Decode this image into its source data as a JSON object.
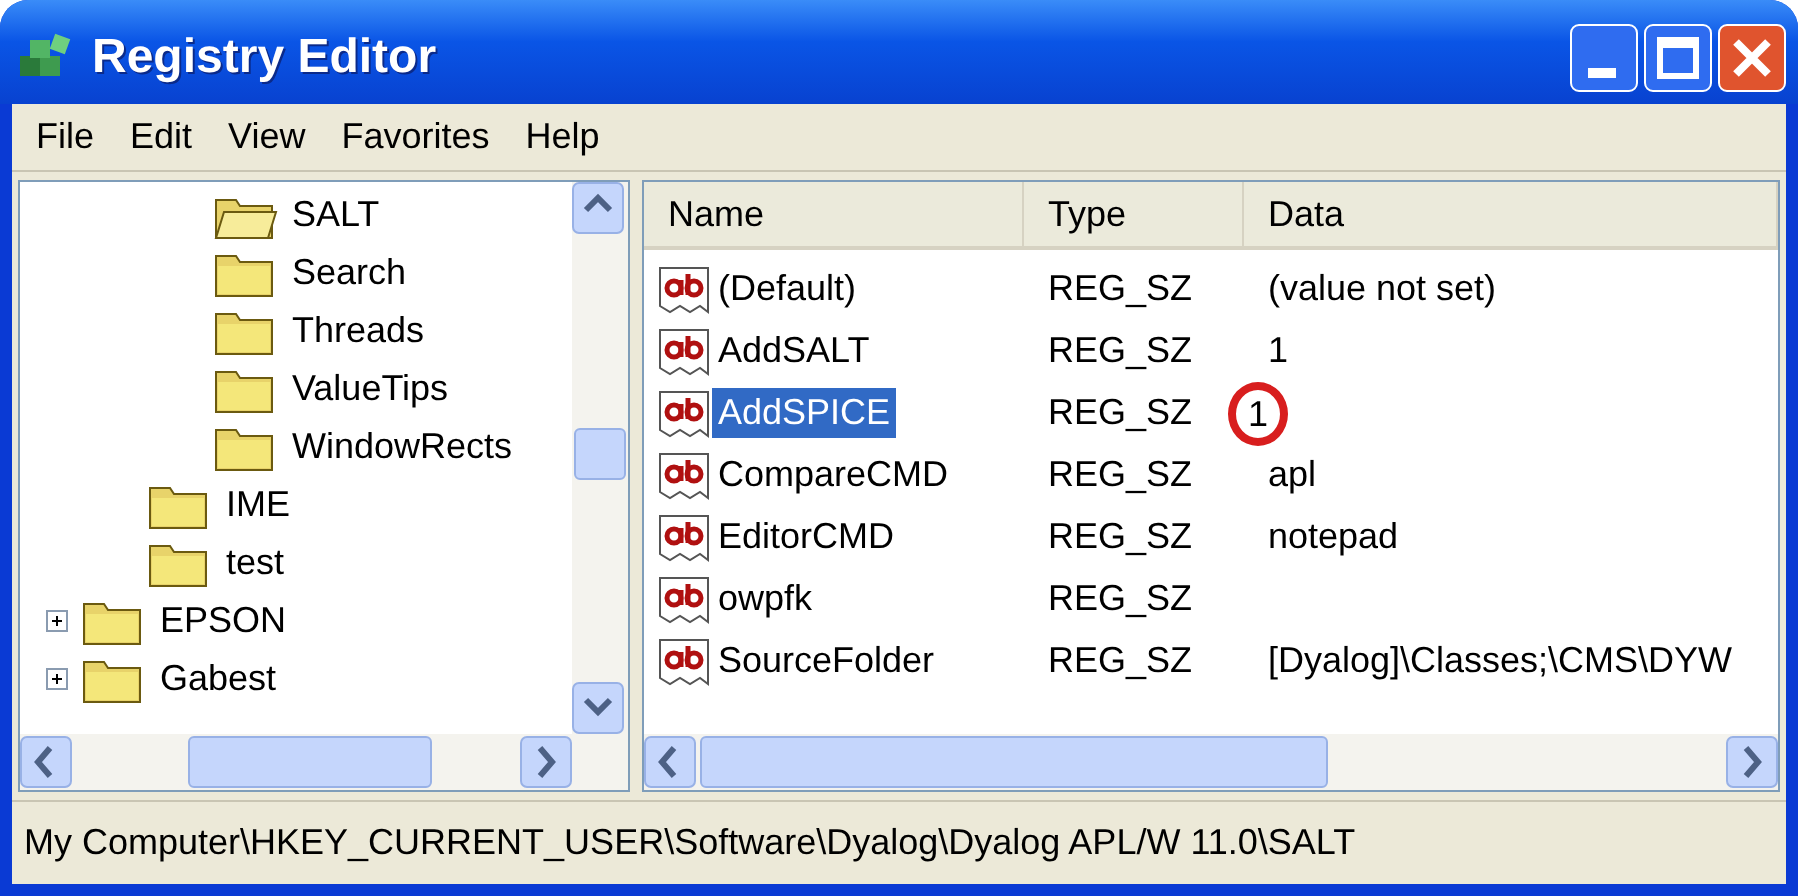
{
  "window": {
    "title": "Registry Editor"
  },
  "menu": [
    "File",
    "Edit",
    "View",
    "Favorites",
    "Help"
  ],
  "tree": [
    {
      "children": [
        {
          "children": [
            {
              "label": "SALT",
              "open": true
            },
            {
              "label": "Search",
              "open": false
            },
            {
              "label": "Threads",
              "open": false
            },
            {
              "label": "ValueTips",
              "open": false
            },
            {
              "label": "WindowRects",
              "open": false
            }
          ]
        },
        {
          "label": "IME",
          "open": false
        },
        {
          "label": "test",
          "open": false
        }
      ]
    },
    {
      "label": "EPSON",
      "open": false,
      "expanded": false
    },
    {
      "label": "Gabest",
      "open": false,
      "expanded": false
    }
  ],
  "list": {
    "columns": [
      "Name",
      "Type",
      "Data"
    ],
    "rows": [
      {
        "name": "(Default)",
        "type": "REG_SZ",
        "data": "(value not set)",
        "selected": false,
        "circled": false
      },
      {
        "name": "AddSALT",
        "type": "REG_SZ",
        "data": "1",
        "selected": false,
        "circled": false
      },
      {
        "name": "AddSPICE",
        "type": "REG_SZ",
        "data": "1",
        "selected": true,
        "circled": true
      },
      {
        "name": "CompareCMD",
        "type": "REG_SZ",
        "data": "apl",
        "selected": false,
        "circled": false
      },
      {
        "name": "EditorCMD",
        "type": "REG_SZ",
        "data": "notepad",
        "selected": false,
        "circled": false
      },
      {
        "name": "owpfk",
        "type": "REG_SZ",
        "data": "",
        "selected": false,
        "circled": false
      },
      {
        "name": "SourceFolder",
        "type": "REG_SZ",
        "data": "[Dyalog]\\Classes;\\CMS\\DYW",
        "selected": false,
        "circled": false
      }
    ]
  },
  "status_bar": "My Computer\\HKEY_CURRENT_USER\\Software\\Dyalog\\Dyalog APL/W 11.0\\SALT"
}
